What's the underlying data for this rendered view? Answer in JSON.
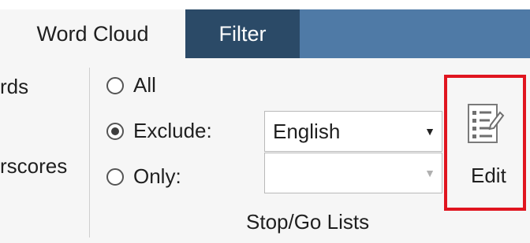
{
  "tabs": {
    "word_cloud": "Word Cloud",
    "filter": "Filter"
  },
  "left_group": {
    "label_1": "rds",
    "label_2": "rscores"
  },
  "stop_go": {
    "options": {
      "all": "All",
      "exclude": "Exclude:",
      "only": "Only:"
    },
    "selected_option": "Exclude:",
    "exclude_select_value": "English",
    "only_select_value": "",
    "group_label": "Stop/Go Lists"
  },
  "edit": {
    "label": "Edit",
    "icon": "list-edit-icon",
    "highlight_color": "#e0151f"
  },
  "colors": {
    "tab_active_bg": "#f6f6f6",
    "tab_filter_bg": "#2b4a67",
    "tabbar_accent": "#4f7aa6"
  }
}
